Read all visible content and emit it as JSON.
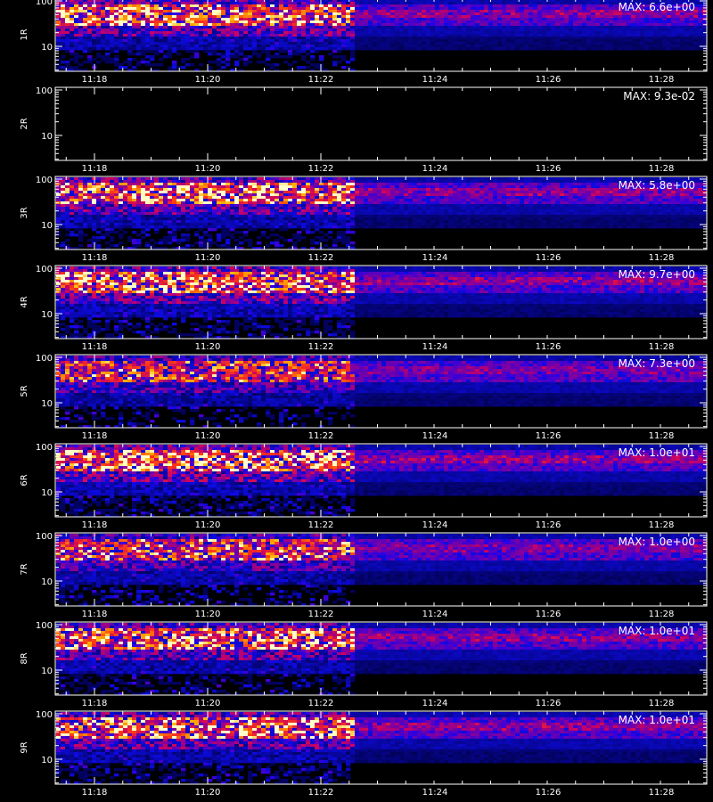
{
  "chart_data": [
    {
      "type": "heatmap",
      "ylabel": "1R",
      "max_label": "MAX: 6.6e+00",
      "yticks": [
        "100",
        "10"
      ],
      "xticks": [
        "11:18",
        "11:20",
        "11:22",
        "11:24",
        "11:26",
        "11:28"
      ],
      "intensity": 0.72,
      "has_data": true
    },
    {
      "type": "heatmap",
      "ylabel": "2R",
      "max_label": "MAX: 9.3e-02",
      "yticks": [
        "100",
        "10"
      ],
      "xticks": [
        "11:18",
        "11:20",
        "11:22",
        "11:24",
        "11:26",
        "11:28"
      ],
      "intensity": 0.0,
      "has_data": false
    },
    {
      "type": "heatmap",
      "ylabel": "3R",
      "max_label": "MAX: 5.8e+00",
      "yticks": [
        "100",
        "10"
      ],
      "xticks": [
        "11:18",
        "11:20",
        "11:22",
        "11:24",
        "11:26",
        "11:28"
      ],
      "intensity": 0.75,
      "has_data": true
    },
    {
      "type": "heatmap",
      "ylabel": "4R",
      "max_label": "MAX: 9.7e+00",
      "yticks": [
        "100",
        "10"
      ],
      "xticks": [
        "11:18",
        "11:20",
        "11:22",
        "11:24",
        "11:26",
        "11:28"
      ],
      "intensity": 0.8,
      "has_data": true
    },
    {
      "type": "heatmap",
      "ylabel": "5R",
      "max_label": "MAX: 7.3e+00",
      "yticks": [
        "100",
        "10"
      ],
      "xticks": [
        "11:18",
        "11:20",
        "11:22",
        "11:24",
        "11:26",
        "11:28"
      ],
      "intensity": 0.5,
      "has_data": true
    },
    {
      "type": "heatmap",
      "ylabel": "6R",
      "max_label": "MAX: 1.0e+01",
      "yticks": [
        "100",
        "10"
      ],
      "xticks": [
        "11:18",
        "11:20",
        "11:22",
        "11:24",
        "11:26",
        "11:28"
      ],
      "intensity": 0.85,
      "has_data": true
    },
    {
      "type": "heatmap",
      "ylabel": "7R",
      "max_label": "MAX: 1.0e+00",
      "yticks": [
        "100",
        "10"
      ],
      "xticks": [
        "11:18",
        "11:20",
        "11:22",
        "11:24",
        "11:26",
        "11:28"
      ],
      "intensity": 0.55,
      "has_data": true
    },
    {
      "type": "heatmap",
      "ylabel": "8R",
      "max_label": "MAX: 1.0e+01",
      "yticks": [
        "100",
        "10"
      ],
      "xticks": [
        "11:18",
        "11:20",
        "11:22",
        "11:24",
        "11:26",
        "11:28"
      ],
      "intensity": 0.7,
      "has_data": true
    },
    {
      "type": "heatmap",
      "ylabel": "9R",
      "max_label": "MAX: 1.0e+01",
      "yticks": [
        "100",
        "10"
      ],
      "xticks": [
        "11:18",
        "11:20",
        "11:22",
        "11:24",
        "11:26",
        "11:28"
      ],
      "intensity": 0.75,
      "has_data": true
    }
  ]
}
